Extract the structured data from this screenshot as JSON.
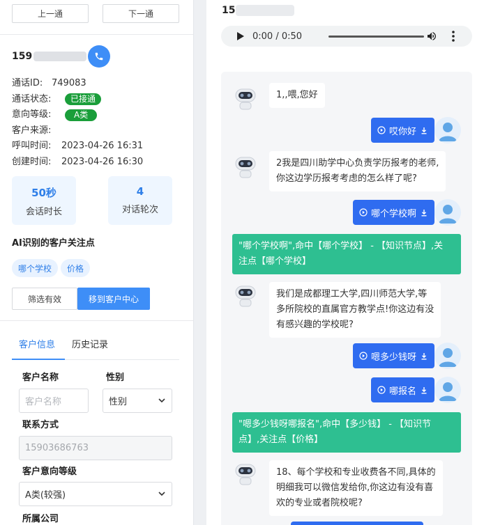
{
  "nav": {
    "prev": "上一通",
    "next": "下一通"
  },
  "customer": {
    "phone_prefix": "159",
    "call_id_label": "通话ID:",
    "call_id": "749083",
    "status_label": "通话状态:",
    "status": "已接通",
    "intent_label": "意向等级:",
    "intent": "A类",
    "source_label": "客户来源:",
    "source": "",
    "call_time_label": "呼叫时间:",
    "call_time": "2023-04-26 16:31",
    "created_label": "创建时间:",
    "created": "2023-04-26 16:30",
    "status_color": "#1a9e3a"
  },
  "stats": [
    {
      "value": "50秒",
      "label": "会话时长"
    },
    {
      "value": "4",
      "label": "对话轮次"
    }
  ],
  "focus": {
    "title": "AI识别的客户关注点",
    "chips": [
      "哪个学校",
      "价格"
    ]
  },
  "actions": {
    "filter": "筛选有效",
    "move": "移到客户中心"
  },
  "tabs": [
    {
      "label": "客户信息",
      "active": true
    },
    {
      "label": "历史记录",
      "active": false
    }
  ],
  "form": {
    "name_label": "客户名称",
    "name_placeholder": "客户名称",
    "gender_label": "性别",
    "gender_value": "性别",
    "contact_label": "联系方式",
    "contact_value": "15903686763",
    "level_label": "客户意向等级",
    "level_value": "A类(较强)",
    "company_label": "所属公司"
  },
  "player": {
    "phone_prefix": "15",
    "time": "0:00 / 0:50"
  },
  "chat": {
    "bot_1": "1,,喂,您好",
    "user_1": "哎你好",
    "bot_2a": "2我是四川助学中心负责学历报考的老师,",
    "bot_2b": "你这边学历报考考虑的怎么样了呢?",
    "user_2": "哪个学校啊",
    "hit_1a": "\"哪个学校啊\",命中【哪个学校】 - 【知识节点】,关",
    "hit_1b": "注点【哪个学校】",
    "bot_3a": "我们是成都理工大学,四川师范大学,等",
    "bot_3b": "多所院校的直属官方教学点!你这边有没",
    "bot_3c": "有感兴趣的学校呢?",
    "user_3": "嗯多少钱呀",
    "user_4": "哪报名",
    "hit_2a": "\"嗯多少钱呀哪报名\",命中【多少钱】 - 【知识节",
    "hit_2b": "点】,关注点【价格】",
    "bot_4a": "18、每个学校和专业收费各不同,具体的",
    "bot_4b": "明细我可以微信发给你,你这边有没有喜",
    "bot_4c": "欢的专业或者院校呢?",
    "hit_color": "#2ebf91",
    "user_color": "#2f6cf0"
  }
}
